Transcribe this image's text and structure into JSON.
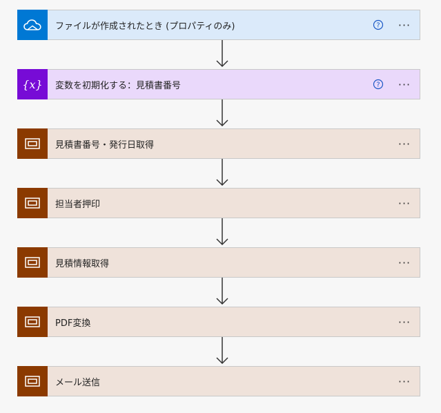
{
  "steps": [
    {
      "label": "ファイルが作成されたとき (プロパティのみ)",
      "icon": "onedrive-cloud-icon",
      "icon_bg": "#0078d4",
      "bg": "#dbeafa",
      "help": true
    },
    {
      "label": "変数を初期化する：見積書番号",
      "icon": "variable-icon",
      "icon_bg": "#770bd6",
      "bg": "#ead9fb",
      "help": true
    },
    {
      "label": "見積書番号・発行日取得",
      "icon": "excel-scope-icon",
      "icon_bg": "#8b3a00",
      "bg": "#efe2da",
      "help": false
    },
    {
      "label": "担当者押印",
      "icon": "excel-scope-icon",
      "icon_bg": "#8b3a00",
      "bg": "#efe2da",
      "help": false
    },
    {
      "label": "見積情報取得",
      "icon": "excel-scope-icon",
      "icon_bg": "#8b3a00",
      "bg": "#efe2da",
      "help": false
    },
    {
      "label": "PDF変換",
      "icon": "excel-scope-icon",
      "icon_bg": "#8b3a00",
      "bg": "#efe2da",
      "help": false
    },
    {
      "label": "メール送信",
      "icon": "excel-scope-icon",
      "icon_bg": "#8b3a00",
      "bg": "#efe2da",
      "help": false
    }
  ],
  "more_label": "···",
  "help_glyph": "?",
  "variable_glyph": "{x}"
}
